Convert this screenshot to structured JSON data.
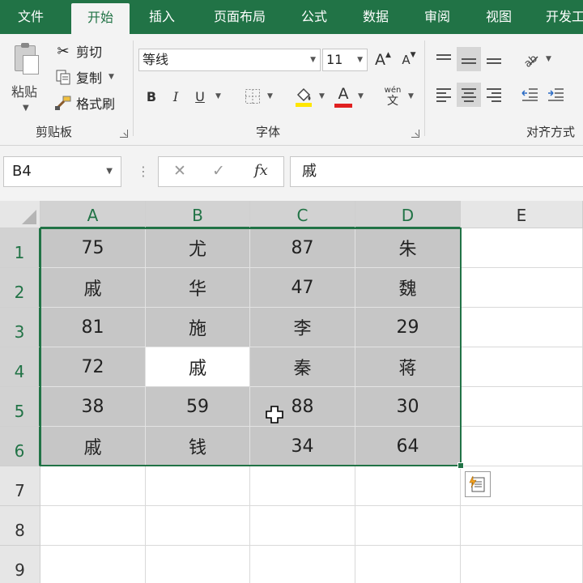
{
  "tabs": [
    {
      "label": "文件",
      "active": false
    },
    {
      "label": "开始",
      "active": true
    },
    {
      "label": "插入",
      "active": false
    },
    {
      "label": "页面布局",
      "active": false
    },
    {
      "label": "公式",
      "active": false
    },
    {
      "label": "数据",
      "active": false
    },
    {
      "label": "审阅",
      "active": false
    },
    {
      "label": "视图",
      "active": false
    },
    {
      "label": "开发工",
      "active": false
    }
  ],
  "ribbon": {
    "clipboard": {
      "paste_label": "粘贴",
      "cut_label": "剪切",
      "copy_label": "复制",
      "format_painter_label": "格式刷",
      "group_label": "剪贴板"
    },
    "font": {
      "font_name": "等线",
      "font_size": "11",
      "bold_label": "B",
      "italic_label": "I",
      "underline_label": "U",
      "grow_label": "A",
      "shrink_label": "A",
      "font_color_label": "A",
      "phonetic_label": "wén",
      "phonetic_sub": "文",
      "group_label": "字体"
    },
    "alignment": {
      "group_label": "对齐方式"
    }
  },
  "formula_bar": {
    "name_box": "B4",
    "cancel_glyph": "✕",
    "enter_glyph": "✓",
    "fx_label": "fx",
    "content": "戚"
  },
  "sheet": {
    "columns": [
      "A",
      "B",
      "C",
      "D",
      "E"
    ],
    "rows": [
      "1",
      "2",
      "3",
      "4",
      "5",
      "6",
      "7",
      "8",
      "9"
    ],
    "cells": [
      [
        "75",
        "尤",
        "87",
        "朱",
        ""
      ],
      [
        "戚",
        "华",
        "47",
        "魏",
        ""
      ],
      [
        "81",
        "施",
        "李",
        "29",
        ""
      ],
      [
        "72",
        "戚",
        "秦",
        "蒋",
        ""
      ],
      [
        "38",
        "59",
        "88",
        "30",
        ""
      ],
      [
        "戚",
        "钱",
        "34",
        "64",
        ""
      ],
      [
        "",
        "",
        "",
        "",
        ""
      ],
      [
        "",
        "",
        "",
        "",
        ""
      ],
      [
        "",
        "",
        "",
        "",
        ""
      ]
    ],
    "selection": "A1:D6",
    "active_cell": "B4"
  },
  "colors": {
    "brand": "#217346",
    "selection_fill": "#c6c6c6",
    "font_color_bar": "#e02020",
    "fill_color_bar": "#ffe600"
  },
  "icons": {
    "cut": "scissors-icon",
    "copy": "copy-icon",
    "format_painter": "brush-icon",
    "fill_color": "paint-bucket-icon",
    "quick_analysis": "quick-analysis-icon"
  }
}
